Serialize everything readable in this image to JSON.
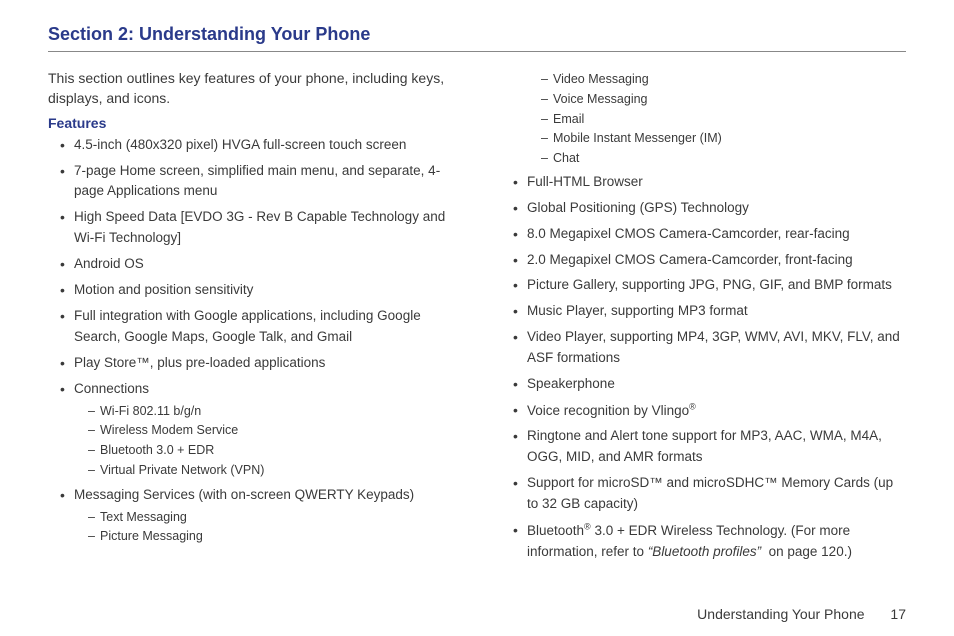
{
  "section_title": "Section 2: Understanding Your Phone",
  "intro": "This section outlines key features of your phone, including keys, displays, and icons.",
  "subhead": "Features",
  "col1": [
    {
      "text": "4.5-inch (480x320 pixel) HVGA full-screen touch screen"
    },
    {
      "text": "7-page Home screen, simplified main menu, and separate, 4-page Applications menu"
    },
    {
      "text": "High Speed Data [EVDO 3G - Rev B Capable Technology and Wi-Fi Technology]"
    },
    {
      "text": "Android OS"
    },
    {
      "text": "Motion and position sensitivity"
    },
    {
      "text": "Full integration with Google applications, including Google Search, Google Maps, Google Talk, and Gmail"
    },
    {
      "text": "Play Store™, plus pre-loaded applications"
    },
    {
      "text": "Connections",
      "sub": [
        "Wi-Fi 802.11 b/g/n",
        "Wireless Modem Service",
        "Bluetooth 3.0 + EDR",
        "Virtual Private Network (VPN)"
      ]
    },
    {
      "text": "Messaging Services (with on-screen QWERTY Keypads)",
      "sub": [
        "Text Messaging",
        "Picture Messaging"
      ]
    }
  ],
  "col2_top_sub": [
    "Video Messaging",
    "Voice Messaging",
    "Email",
    "Mobile Instant Messenger (IM)",
    "Chat"
  ],
  "col2": [
    {
      "text": "Full-HTML Browser"
    },
    {
      "text": "Global Positioning (GPS) Technology"
    },
    {
      "text": "8.0 Megapixel CMOS Camera-Camcorder, rear-facing"
    },
    {
      "text": "2.0 Megapixel CMOS Camera-Camcorder, front-facing"
    },
    {
      "text": "Picture Gallery, supporting JPG, PNG, GIF, and BMP formats"
    },
    {
      "text": "Music Player, supporting MP3 format"
    },
    {
      "text": "Video Player, supporting MP4, 3GP, WMV, AVI, MKV, FLV, and ASF formations"
    },
    {
      "text": "Speakerphone"
    },
    {
      "html": "Voice recognition by Vlingo<sup>®</sup>"
    },
    {
      "text": "Ringtone and Alert tone support for MP3, AAC, WMA, M4A, OGG, MID, and AMR formats"
    },
    {
      "text": "Support for microSD™ and microSDHC™ Memory Cards (up to 32 GB capacity)"
    },
    {
      "html": "Bluetooth<sup>®</sup> 3.0 + EDR Wireless Technology. (For more information, refer to <span class=\"crossref-italic\">“Bluetooth profiles”</span>&nbsp; on page 120.)"
    }
  ],
  "footer": {
    "label": "Understanding Your Phone",
    "page": "17"
  }
}
